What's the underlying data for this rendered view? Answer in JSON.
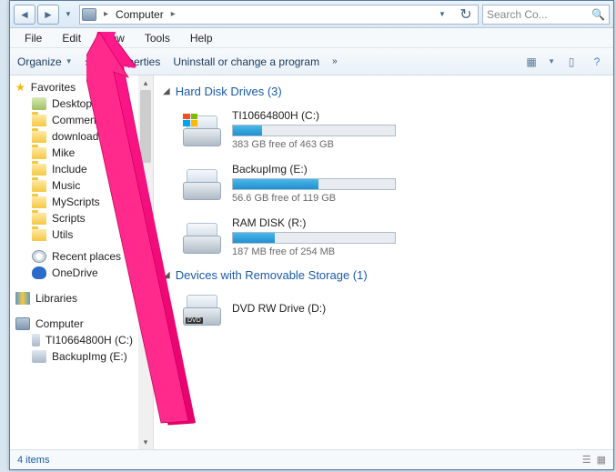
{
  "address": {
    "location": "Computer"
  },
  "search": {
    "placeholder": "Search Co..."
  },
  "menubar": [
    "File",
    "Edit",
    "View",
    "Tools",
    "Help"
  ],
  "toolbar": {
    "organize": "Organize",
    "props": "stem properties",
    "uninstall": "Uninstall or change a program"
  },
  "sidebar": {
    "favorites": {
      "label": "Favorites",
      "items": [
        "Desktop",
        "Commented",
        "download",
        "Mike",
        "Include",
        "Music",
        "MyScripts",
        "Scripts",
        "Utils"
      ],
      "recent": "Recent places",
      "onedrive": "OneDrive"
    },
    "libraries": {
      "label": "Libraries"
    },
    "computer": {
      "label": "Computer",
      "items": [
        "TI10664800H (C:)",
        "BackupImg (E:)"
      ]
    }
  },
  "sections": {
    "hdd": {
      "title": "Hard Disk Drives (3)"
    },
    "removable": {
      "title": "Devices with Removable Storage (1)"
    }
  },
  "drives": {
    "c": {
      "name": "TI10664800H (C:)",
      "free": "383 GB free of 463 GB",
      "fill": 18
    },
    "e": {
      "name": "BackupImg (E:)",
      "free": "56.6 GB free of 119 GB",
      "fill": 53
    },
    "r": {
      "name": "RAM DISK (R:)",
      "free": "187 MB free of 254 MB",
      "fill": 26
    },
    "d": {
      "name": "DVD RW Drive (D:)"
    }
  },
  "status": {
    "count": "4 items"
  }
}
